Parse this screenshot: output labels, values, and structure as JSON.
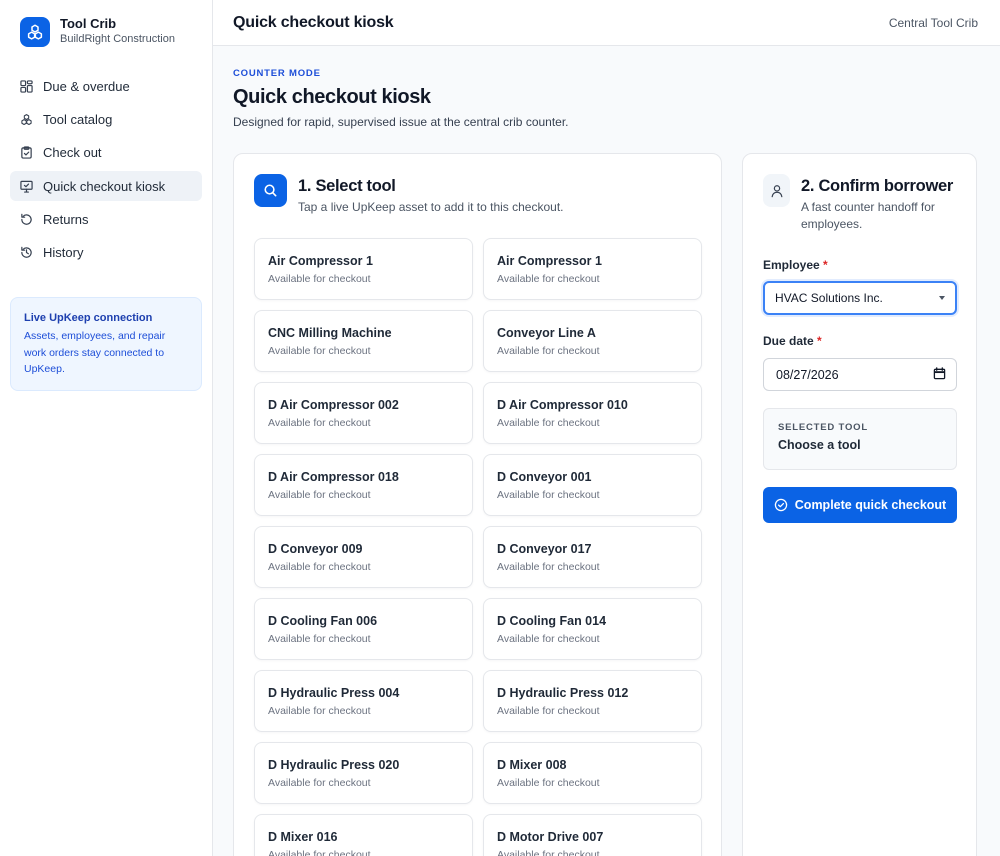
{
  "brand": {
    "name": "Tool Crib",
    "org": "BuildRight Construction"
  },
  "nav": [
    {
      "label": "Due & overdue",
      "icon": "grid-icon",
      "active": false
    },
    {
      "label": "Tool catalog",
      "icon": "boxes-icon",
      "active": false
    },
    {
      "label": "Check out",
      "icon": "clipboard-check-icon",
      "active": false
    },
    {
      "label": "Quick checkout kiosk",
      "icon": "monitor-icon",
      "active": true
    },
    {
      "label": "Returns",
      "icon": "rotate-left-icon",
      "active": false
    },
    {
      "label": "History",
      "icon": "history-icon",
      "active": false
    }
  ],
  "info": {
    "title": "Live UpKeep connection",
    "text": "Assets, employees, and repair work orders stay connected to UpKeep."
  },
  "header": {
    "title": "Quick checkout kiosk",
    "location": "Central Tool Crib"
  },
  "page": {
    "eyebrow": "COUNTER MODE",
    "title": "Quick checkout kiosk",
    "subtitle": "Designed for rapid, supervised issue at the central crib counter."
  },
  "select_tool": {
    "title": "1. Select tool",
    "subtitle": "Tap a live UpKeep asset to add it to this checkout.",
    "tools": [
      {
        "name": "Air Compressor 1",
        "status": "Available for checkout"
      },
      {
        "name": "Air Compressor 1",
        "status": "Available for checkout"
      },
      {
        "name": "CNC Milling Machine",
        "status": "Available for checkout"
      },
      {
        "name": "Conveyor Line A",
        "status": "Available for checkout"
      },
      {
        "name": "D Air Compressor 002",
        "status": "Available for checkout"
      },
      {
        "name": "D Air Compressor 010",
        "status": "Available for checkout"
      },
      {
        "name": "D Air Compressor 018",
        "status": "Available for checkout"
      },
      {
        "name": "D Conveyor 001",
        "status": "Available for checkout"
      },
      {
        "name": "D Conveyor 009",
        "status": "Available for checkout"
      },
      {
        "name": "D Conveyor 017",
        "status": "Available for checkout"
      },
      {
        "name": "D Cooling Fan 006",
        "status": "Available for checkout"
      },
      {
        "name": "D Cooling Fan 014",
        "status": "Available for checkout"
      },
      {
        "name": "D Hydraulic Press 004",
        "status": "Available for checkout"
      },
      {
        "name": "D Hydraulic Press 012",
        "status": "Available for checkout"
      },
      {
        "name": "D Hydraulic Press 020",
        "status": "Available for checkout"
      },
      {
        "name": "D Mixer 008",
        "status": "Available for checkout"
      },
      {
        "name": "D Mixer 016",
        "status": "Available for checkout"
      },
      {
        "name": "D Motor Drive 007",
        "status": "Available for checkout"
      }
    ]
  },
  "borrower": {
    "title": "2. Confirm borrower",
    "subtitle": "A fast counter handoff for employees.",
    "employee_label": "Employee",
    "employee_value": "HVAC Solutions Inc.",
    "due_label": "Due date",
    "due_value": "08/27/2026",
    "required_mark": "*",
    "selected_label": "SELECTED TOOL",
    "selected_value": "Choose a tool",
    "submit_label": "Complete quick checkout"
  },
  "colors": {
    "accent": "#0b63e5",
    "required": "#dc2626",
    "info_bg": "#eff6ff"
  }
}
